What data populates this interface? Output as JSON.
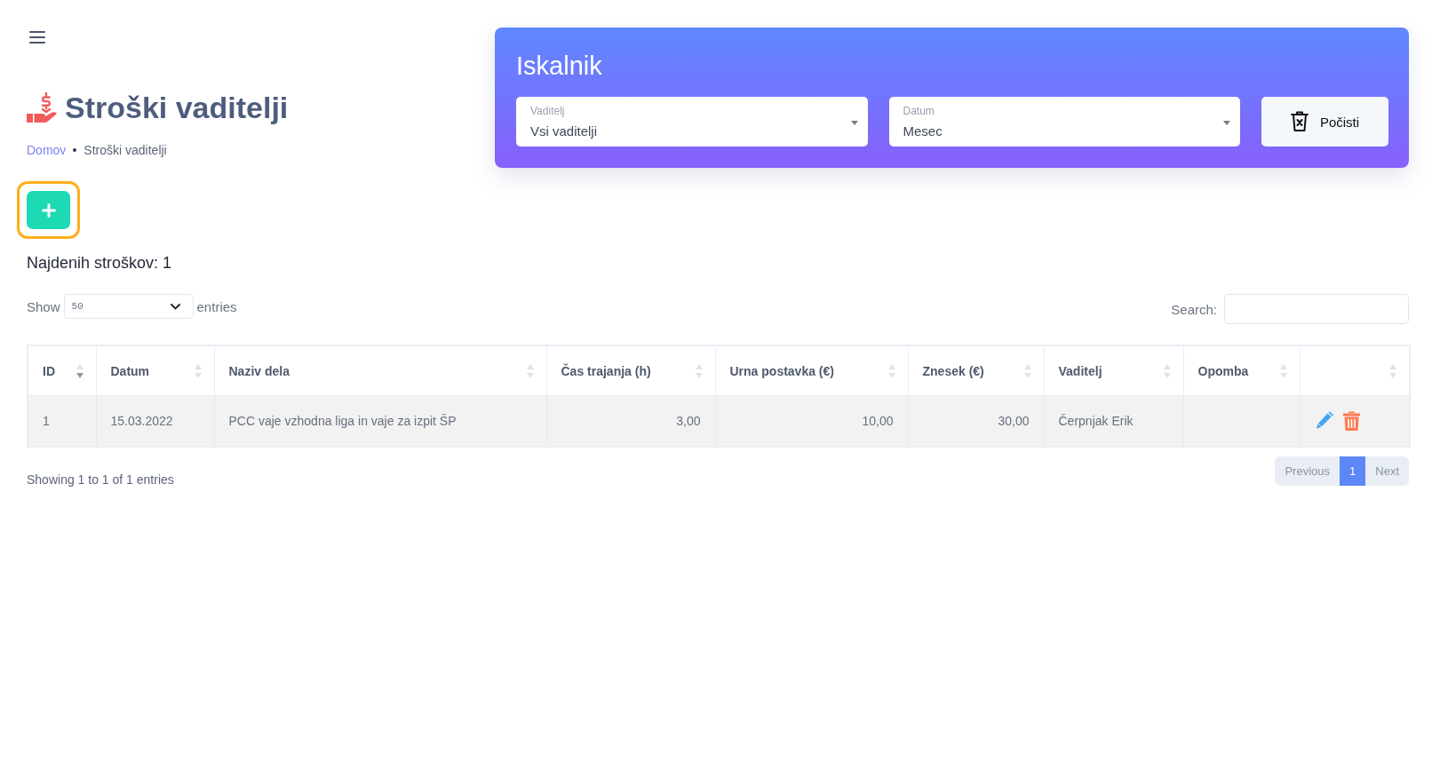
{
  "header": {
    "title": "Stroški vaditelji"
  },
  "breadcrumb": [
    {
      "label": "Domov",
      "kind": "link"
    },
    {
      "label": "Stroški vaditelji",
      "kind": "current"
    }
  ],
  "add_button": {
    "focused": true
  },
  "result_count": "Najdenih stroškov: 1",
  "search_panel": {
    "title": "Iskalnik",
    "filters": [
      {
        "label": "Vaditelj",
        "value": "Vsi vaditelji"
      },
      {
        "label": "Datum",
        "value": "Mesec"
      }
    ],
    "clear_button": "Počisti"
  },
  "table_controls": {
    "show_label": "Show",
    "page_length": "50",
    "entries_label": "entries",
    "search_label": "Search:"
  },
  "table": {
    "columns": [
      {
        "label": "ID",
        "sorted": true
      },
      {
        "label": "Datum",
        "sorted": false
      },
      {
        "label": "Naziv dela",
        "sorted": false
      },
      {
        "label": "Čas trajanja (h)",
        "sorted": false
      },
      {
        "label": "Urna postavka (€)",
        "sorted": false
      },
      {
        "label": "Znesek (€)",
        "sorted": false
      },
      {
        "label": "Vaditelj",
        "sorted": false
      },
      {
        "label": "Opomba",
        "sorted": false
      },
      {
        "sorted": false
      }
    ],
    "rows": [
      {
        "cells": [
          "1",
          "15.03.2022",
          "PCC vaje vzhodna liga in vaje za izpit ŠP",
          "3,00",
          "10,00",
          "30,00",
          "Čerpnjak Erik"
        ]
      }
    ]
  },
  "footer": {
    "info": "Showing 1 to 1 of 1 entries",
    "previous": "Previous",
    "pages": [
      {
        "label": "1",
        "selected": true
      }
    ],
    "next": "Next"
  }
}
